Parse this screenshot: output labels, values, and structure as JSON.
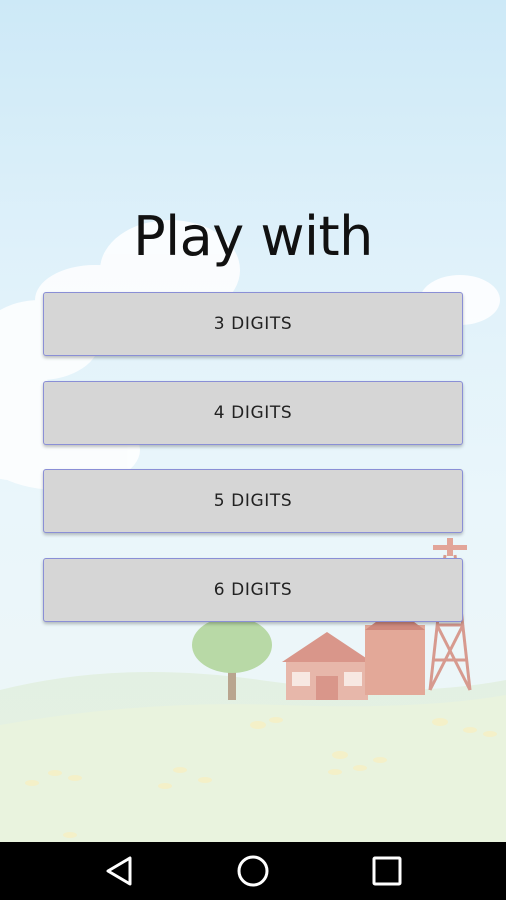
{
  "heading": "Play with",
  "buttons": [
    {
      "label": "3 DIGITS"
    },
    {
      "label": "4 DIGITS"
    },
    {
      "label": "5 DIGITS"
    },
    {
      "label": "6 DIGITS"
    }
  ],
  "navbar": {
    "back_icon": "back-triangle-icon",
    "home_icon": "home-circle-icon",
    "recents_icon": "recents-square-icon"
  },
  "colors": {
    "button_bg": "#d6d6d6",
    "button_border": "#8a8fd6",
    "navbar_bg": "#000000"
  }
}
